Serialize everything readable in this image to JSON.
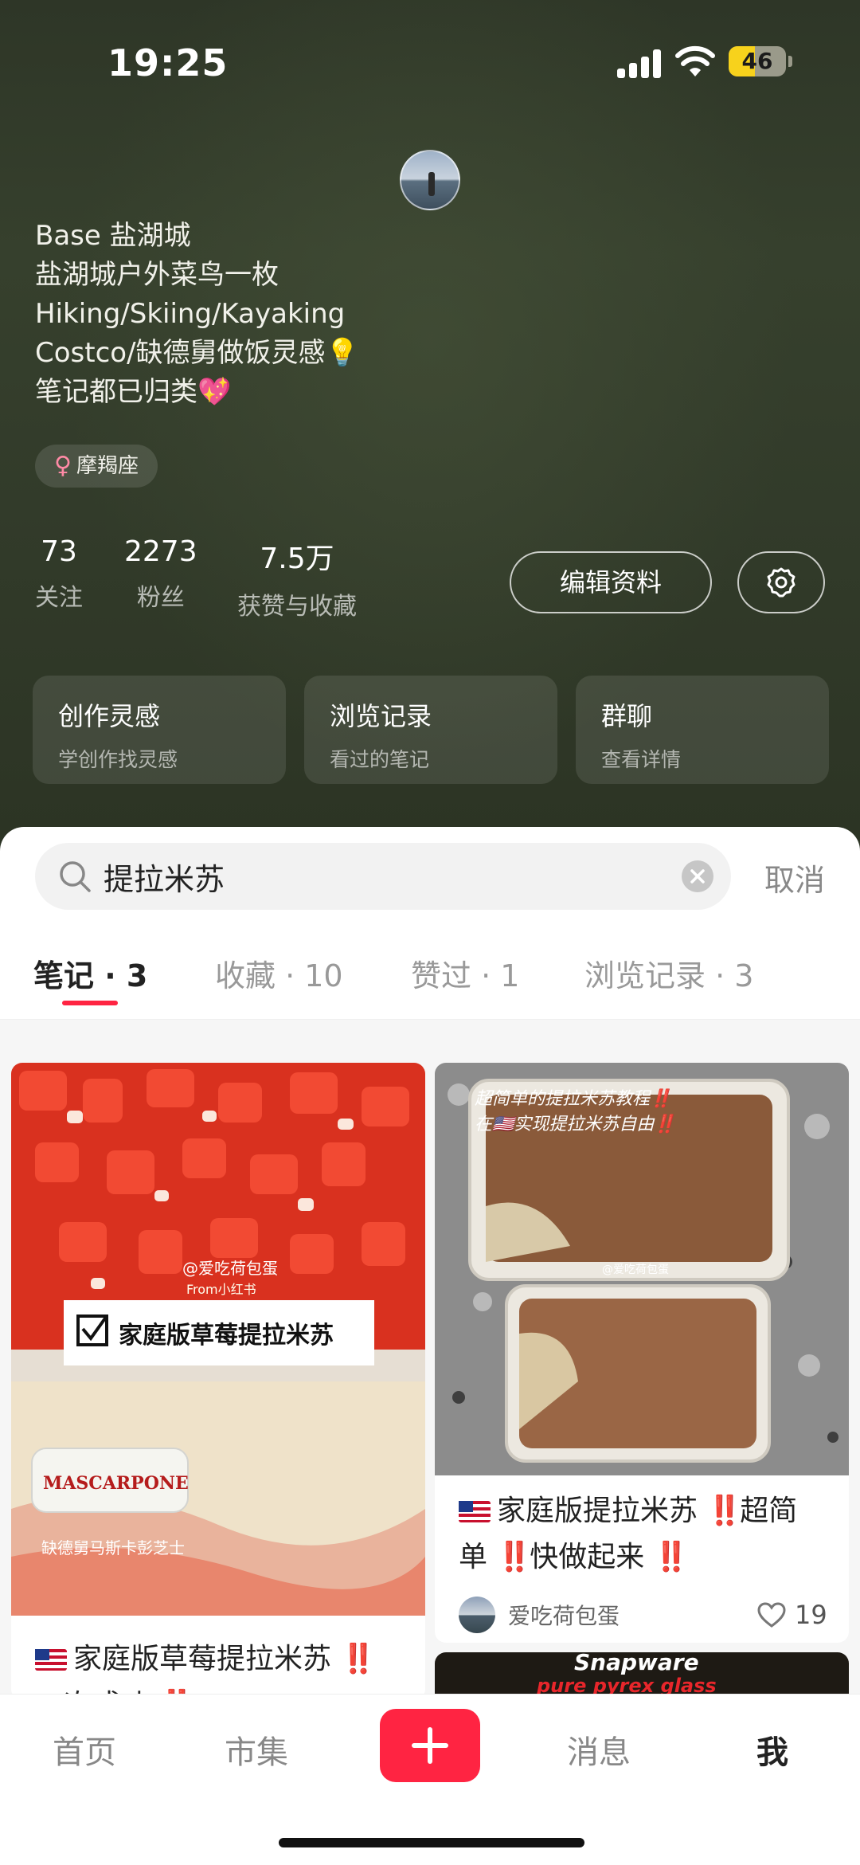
{
  "status_bar": {
    "time": "19:25",
    "battery": "46",
    "battery_level": 0.46
  },
  "profile": {
    "bio_lines": [
      "Base 盐湖城",
      "盐湖城户外菜鸟一枚",
      "Hiking/Skiing/Kayaking",
      "Costco/缺德舅做饭灵感💡",
      "笔记都已归类💖"
    ],
    "tag": {
      "symbol": "♀",
      "label": "摩羯座"
    },
    "stats": [
      {
        "value": "73",
        "label": "关注"
      },
      {
        "value": "2273",
        "label": "粉丝"
      },
      {
        "value": "7.5万",
        "label": "获赞与收藏"
      }
    ],
    "edit_label": "编辑资料",
    "cards": [
      {
        "title": "创作灵感",
        "subtitle": "学创作找灵感"
      },
      {
        "title": "浏览记录",
        "subtitle": "看过的笔记"
      },
      {
        "title": "群聊",
        "subtitle": "查看详情"
      }
    ]
  },
  "search": {
    "value": "提拉米苏",
    "cancel_label": "取消"
  },
  "tabs": [
    {
      "label": "笔记 · 3"
    },
    {
      "label": "收藏 · 10"
    },
    {
      "label": "赞过 · 1"
    },
    {
      "label": "浏览记录 · 3"
    }
  ],
  "notes": [
    {
      "title_a": "家庭版草莓提拉米苏",
      "title_b": "一次成功",
      "bang": "‼️",
      "image_watermark": "@爱吃荷包蛋",
      "image_source": "From小红书",
      "image_caption": "家庭版草莓提拉米苏",
      "image_label": "缺德舅马斯卡彭芝士",
      "image_product": "MASCARPONE"
    },
    {
      "title_a": "家庭版提拉米苏",
      "title_b": "超简",
      "title_c": "单",
      "title_d": "快做起来",
      "bang": "‼️",
      "image_caption_1": "超简单的提拉米苏教程‼️",
      "image_caption_2": "在🇺🇸实现提拉米苏自由‼️",
      "image_watermark": "@爱吃荷包蛋",
      "author": "爱吃荷包蛋",
      "likes": "19"
    },
    {
      "image_text_1": "Snapware",
      "image_text_2": "pure pyrex glass"
    }
  ],
  "bottom_nav": [
    {
      "label": "首页"
    },
    {
      "label": "市集"
    },
    {
      "label": "消息"
    },
    {
      "label": "我"
    }
  ],
  "colors": {
    "accent": "#ff2442",
    "header_bg": "#2d3526"
  }
}
